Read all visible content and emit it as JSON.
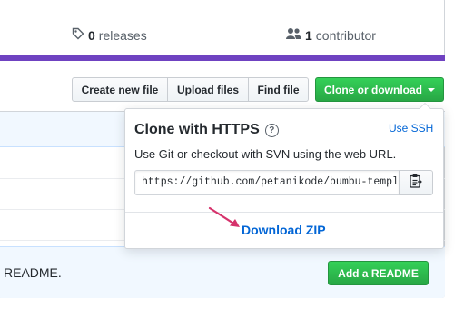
{
  "summary": {
    "releases_count": "0",
    "releases_label": "releases",
    "contributors_count": "1",
    "contributors_label": "contributor"
  },
  "toolbar": {
    "create_new_file": "Create new file",
    "upload_files": "Upload files",
    "find_file": "Find file",
    "clone_or_download": "Clone or download"
  },
  "clone_panel": {
    "title": "Clone with HTTPS",
    "help": "?",
    "use_ssh": "Use SSH",
    "description": "Use Git or checkout with SVN using the web URL.",
    "url": "https://github.com/petanikode/bumbu-templa",
    "download_zip": "Download ZIP"
  },
  "readme": {
    "text": "README.",
    "button": "Add a README"
  },
  "colors": {
    "accent_purple": "#6f42c1",
    "green": "#28a745",
    "link_blue": "#0366d6",
    "annotation_arrow": "#d6336c"
  },
  "icons": [
    "tag-icon",
    "people-icon",
    "help-icon",
    "clipboard-icon",
    "caret-down-icon",
    "annotation-arrow-icon"
  ]
}
